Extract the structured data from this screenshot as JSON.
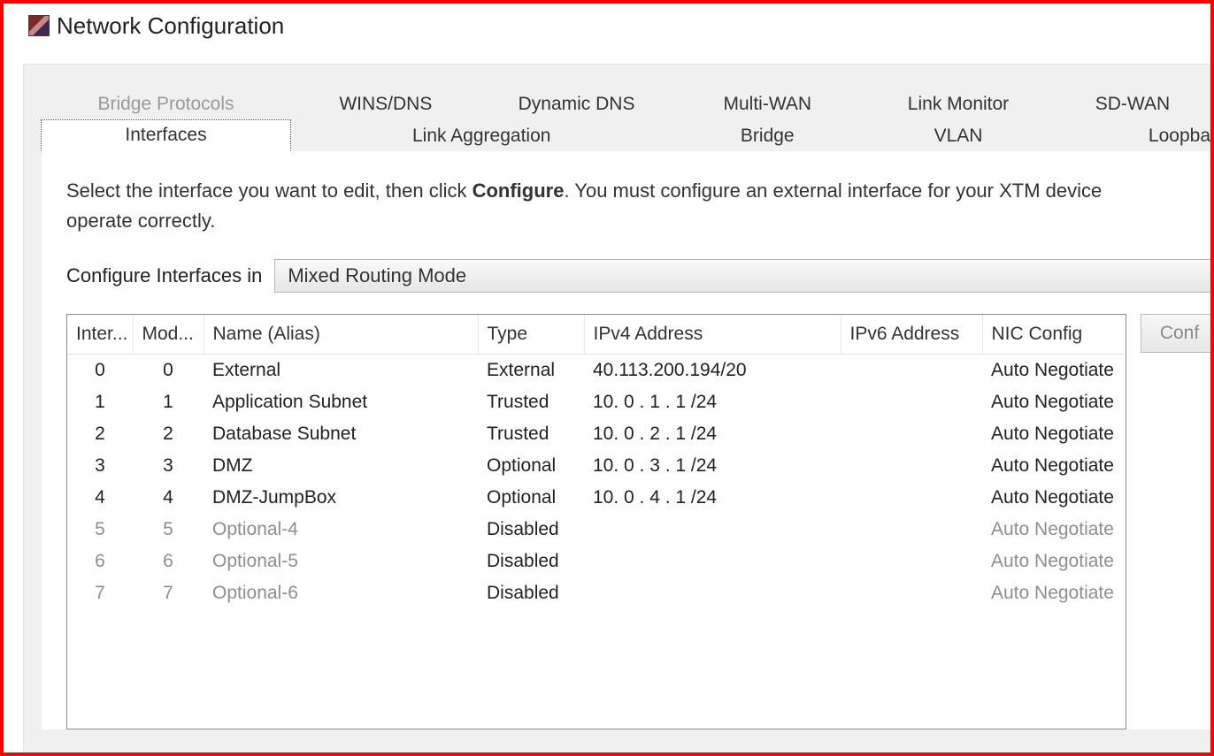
{
  "window": {
    "title": "Network Configuration"
  },
  "tabs": {
    "row1": [
      {
        "id": "bridge-protocols",
        "label": "Bridge Protocols",
        "disabled": true
      },
      {
        "id": "wins-dns",
        "label": "WINS/DNS"
      },
      {
        "id": "dynamic-dns",
        "label": "Dynamic DNS"
      },
      {
        "id": "multi-wan",
        "label": "Multi-WAN"
      },
      {
        "id": "link-monitor",
        "label": "Link Monitor"
      },
      {
        "id": "sd-wan",
        "label": "SD-WAN"
      }
    ],
    "row2": [
      {
        "id": "interfaces",
        "label": "Interfaces",
        "active": true
      },
      {
        "id": "link-aggregation",
        "label": "Link Aggregation"
      },
      {
        "id": "bridge",
        "label": "Bridge"
      },
      {
        "id": "vlan",
        "label": "VLAN"
      },
      {
        "id": "loopback",
        "label": "Loopba"
      }
    ]
  },
  "help": {
    "pre": "Select the interface you want to edit, then click ",
    "bold": "Configure",
    "post": ". You must configure an external interface for your XTM device",
    "line2": "operate correctly."
  },
  "mode": {
    "label": "Configure Interfaces in",
    "selected": "Mixed Routing Mode"
  },
  "table": {
    "headers": {
      "interface": "Inter...",
      "module": "Mod...",
      "name": "Name (Alias)",
      "type": "Type",
      "ipv4": "IPv4 Address",
      "ipv6": "IPv6 Address",
      "nic": "NIC Config"
    },
    "rows": [
      {
        "interface": "0",
        "module": "0",
        "name": "External",
        "type": "External",
        "ipv4": "40.113.200.194/20",
        "ipv6": "",
        "nic": "Auto Negotiate",
        "disabled": false
      },
      {
        "interface": "1",
        "module": "1",
        "name": "Application Subnet",
        "type": "Trusted",
        "ipv4": "10. 0 . 1 . 1 /24",
        "ipv6": "",
        "nic": "Auto Negotiate",
        "disabled": false
      },
      {
        "interface": "2",
        "module": "2",
        "name": "Database Subnet",
        "type": "Trusted",
        "ipv4": "10. 0 . 2 . 1 /24",
        "ipv6": "",
        "nic": "Auto Negotiate",
        "disabled": false
      },
      {
        "interface": "3",
        "module": "3",
        "name": "DMZ",
        "type": "Optional",
        "ipv4": "10. 0 . 3 . 1 /24",
        "ipv6": "",
        "nic": "Auto Negotiate",
        "disabled": false
      },
      {
        "interface": "4",
        "module": "4",
        "name": "DMZ-JumpBox",
        "type": "Optional",
        "ipv4": "10. 0 . 4 . 1 /24",
        "ipv6": "",
        "nic": "Auto Negotiate",
        "disabled": false
      },
      {
        "interface": "5",
        "module": "5",
        "name": "Optional-4",
        "type": "Disabled",
        "ipv4": "",
        "ipv6": "",
        "nic": "Auto Negotiate",
        "disabled": true
      },
      {
        "interface": "6",
        "module": "6",
        "name": "Optional-5",
        "type": "Disabled",
        "ipv4": "",
        "ipv6": "",
        "nic": "Auto Negotiate",
        "disabled": true
      },
      {
        "interface": "7",
        "module": "7",
        "name": "Optional-6",
        "type": "Disabled",
        "ipv4": "",
        "ipv6": "",
        "nic": "Auto Negotiate",
        "disabled": true
      }
    ]
  },
  "buttons": {
    "configure": "Conf"
  }
}
